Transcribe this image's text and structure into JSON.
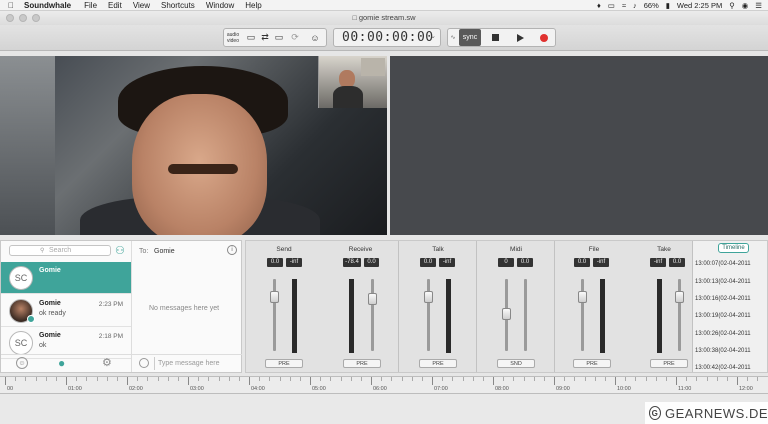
{
  "menubar": {
    "app_name": "Soundwhale",
    "items": [
      "File",
      "Edit",
      "View",
      "Shortcuts",
      "Window",
      "Help"
    ],
    "battery": "66%",
    "clock": "Wed 2:25 PM"
  },
  "window": {
    "title": "gomie stream.sw"
  },
  "toolbar": {
    "audio_label": "audio",
    "video_label": "video",
    "timecode": "00:00:00:00",
    "sync_label": "sync"
  },
  "chat": {
    "search_placeholder": "Search",
    "to_label": "To:",
    "to_name": "Gomie",
    "empty_text": "No messages here yet",
    "message_placeholder": "Type message here",
    "contacts": [
      {
        "initials": "SC",
        "name": "Gomie",
        "message": "",
        "time": ""
      },
      {
        "initials": "",
        "name": "Gomie",
        "message": "ok ready",
        "time": "2:23 PM"
      },
      {
        "initials": "SC",
        "name": "Gomie",
        "message": "ok",
        "time": "2:18 PM"
      }
    ]
  },
  "mixer": {
    "strips": [
      {
        "title": "Send",
        "value": "0.0",
        "peak": "-inf",
        "button": "PRE"
      },
      {
        "title": "Receive",
        "value": "-78.4",
        "peak": "0.0",
        "button": "PRE"
      },
      {
        "title": "Talk",
        "value": "0.0",
        "peak": "-inf",
        "button": "PRE"
      },
      {
        "title": "Midi",
        "value": "0",
        "peak": "0.0",
        "button": "SND"
      },
      {
        "title": "File",
        "value": "0.0",
        "peak": "-inf",
        "button": "PRE"
      },
      {
        "title": "Take",
        "value": "-inf",
        "peak": "0.0",
        "button": "PRE"
      }
    ]
  },
  "timeline": {
    "button": "Timeline",
    "entries": [
      "13:00:07(02-04-2011",
      "13:00:13(02-04-2011",
      "13:00:16(02-04-2011",
      "13:00:19(02-04-2011",
      "13:00:26(02-04-2011",
      "13:00:38(02-04-2011",
      "13:00:42(02-04-2011"
    ]
  },
  "ruler": {
    "labels": [
      "00",
      "01:00",
      "02:00",
      "03:00",
      "04:00",
      "05:00",
      "06:00",
      "07:00",
      "08:00",
      "09:00",
      "10:00",
      "11:00",
      "12:00"
    ]
  },
  "watermark": {
    "icon": "G",
    "text": "GEARNEWS.DE"
  },
  "colors": {
    "accent": "#3fa49a",
    "record": "#e0312f"
  }
}
